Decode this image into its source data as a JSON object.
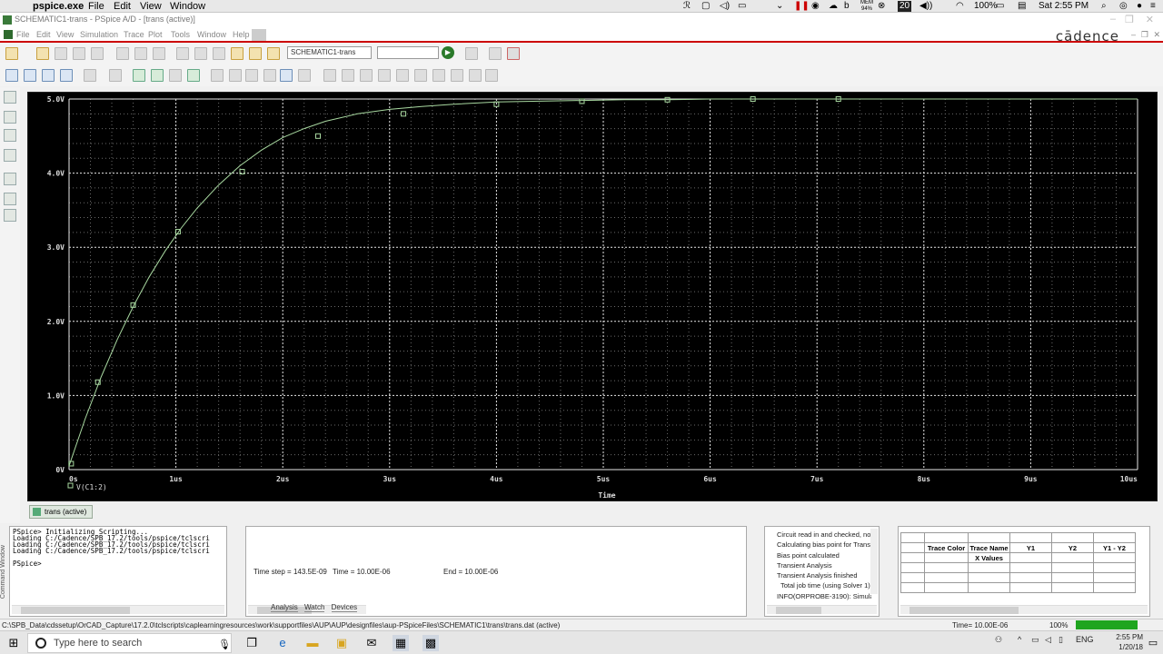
{
  "mac_menubar": {
    "app_name": "pspice.exe",
    "items": [
      "File",
      "Edit",
      "View",
      "Window"
    ],
    "status": {
      "battery": "100%",
      "clock": "Sat 2:55 PM",
      "num_badge": "20",
      "mem_top": "MEM",
      "mem_bottom": "94%"
    }
  },
  "window": {
    "title": "SCHEMATIC1-trans - PSpice A/D - [trans (active)]"
  },
  "menu": {
    "items": [
      "File",
      "Edit",
      "View",
      "Simulation",
      "Trace",
      "Plot",
      "Tools",
      "Window",
      "Help"
    ],
    "logo": "cādence"
  },
  "toolbar": {
    "profile_field": "SCHEMATIC1-trans",
    "run_icon": "play-icon"
  },
  "chart_data": {
    "type": "line",
    "xlabel": "Time",
    "xticks": [
      "0s",
      "1us",
      "2us",
      "3us",
      "4us",
      "5us",
      "6us",
      "7us",
      "8us",
      "9us",
      "10us"
    ],
    "yticks": [
      "0V",
      "1.0V",
      "2.0V",
      "3.0V",
      "4.0V",
      "5.0V"
    ],
    "xlim": [
      0,
      10
    ],
    "ylim": [
      0,
      5
    ],
    "grid": true,
    "series": [
      {
        "name": "V(C1:2)",
        "x": [
          0,
          0.15,
          0.3,
          0.45,
          0.6,
          0.75,
          0.9,
          1.05,
          1.2,
          1.4,
          1.6,
          1.8,
          2.0,
          2.2,
          2.4,
          2.7,
          3.0,
          3.3,
          3.6,
          4.0,
          4.4,
          4.8,
          5.2,
          5.6,
          6.0,
          6.5,
          7.0,
          7.5,
          8.0,
          8.5,
          9.0,
          9.5,
          10.0
        ],
        "y": [
          0.05,
          0.68,
          1.25,
          1.75,
          2.2,
          2.6,
          2.95,
          3.26,
          3.53,
          3.84,
          4.1,
          4.31,
          4.48,
          4.6,
          4.7,
          4.8,
          4.86,
          4.9,
          4.93,
          4.96,
          4.97,
          4.98,
          4.99,
          4.99,
          5.0,
          5.0,
          5.0,
          5.0,
          5.0,
          5.0,
          5.0,
          5.0,
          5.0
        ]
      }
    ],
    "markers": {
      "x": [
        0.02,
        0.27,
        0.6,
        1.02,
        1.62,
        2.33,
        3.13,
        4.0,
        4.8,
        5.6,
        6.4,
        7.2
      ],
      "y": [
        0.08,
        1.18,
        2.22,
        3.21,
        4.02,
        4.5,
        4.8,
        4.93,
        4.97,
        4.99,
        5.0,
        5.0
      ]
    }
  },
  "tab": {
    "label": "trans (active)"
  },
  "command_window": {
    "label": "Command Window",
    "lines": [
      "PSpice> Initializing Scripting...",
      "Loading C:/Cadence/SPB_17.2/tools/pspice/tclscri",
      "Loading C:/Cadence/SPB_17.2/tools/pspice/tclscri",
      "Loading C:/Cadence/SPB_17.2/tools/pspice/tclscri",
      "",
      "PSpice>"
    ]
  },
  "output": {
    "time_step": "Time step = 143.5E-09",
    "time": "Time = 10.00E-06",
    "end": "End = 10.00E-06",
    "tabs": [
      "Analysis",
      "Watch",
      "Devices"
    ]
  },
  "sim_log": [
    "Circuit read in and checked, no",
    "Calculating bias point for Transie",
    "Bias point calculated",
    "Transient Analysis",
    "Transient Analysis finished",
    "Total job time (using Solver 1)",
    "INFO(ORPROBE-3190): Simulat"
  ],
  "probe_table": {
    "headers": [
      "Trace Color",
      "Trace Name",
      "Y1",
      "Y2",
      "Y1 - Y2"
    ],
    "x_values_label": "X Values"
  },
  "statusbar": {
    "path": "C:\\SPB_Data\\cdssetup\\OrCAD_Capture\\17.2.0\\tclscripts\\caplearningresources\\work\\supportfiles\\AUP\\AUP\\designfiles\\aup-PSpiceFiles\\SCHEMATIC1\\trans\\trans.dat (active)",
    "time": "Time= 10.00E-06",
    "zoom": "100%"
  },
  "taskbar": {
    "search_placeholder": "Type here to search",
    "lang": "ENG",
    "time": "2:55 PM",
    "date": "1/20/18"
  },
  "colors": {
    "trace": "#a8d8a0",
    "grid": "#e8e8e8",
    "plot_bg": "#000000",
    "accent": "#cc0000",
    "progress": "#1fa51f"
  }
}
